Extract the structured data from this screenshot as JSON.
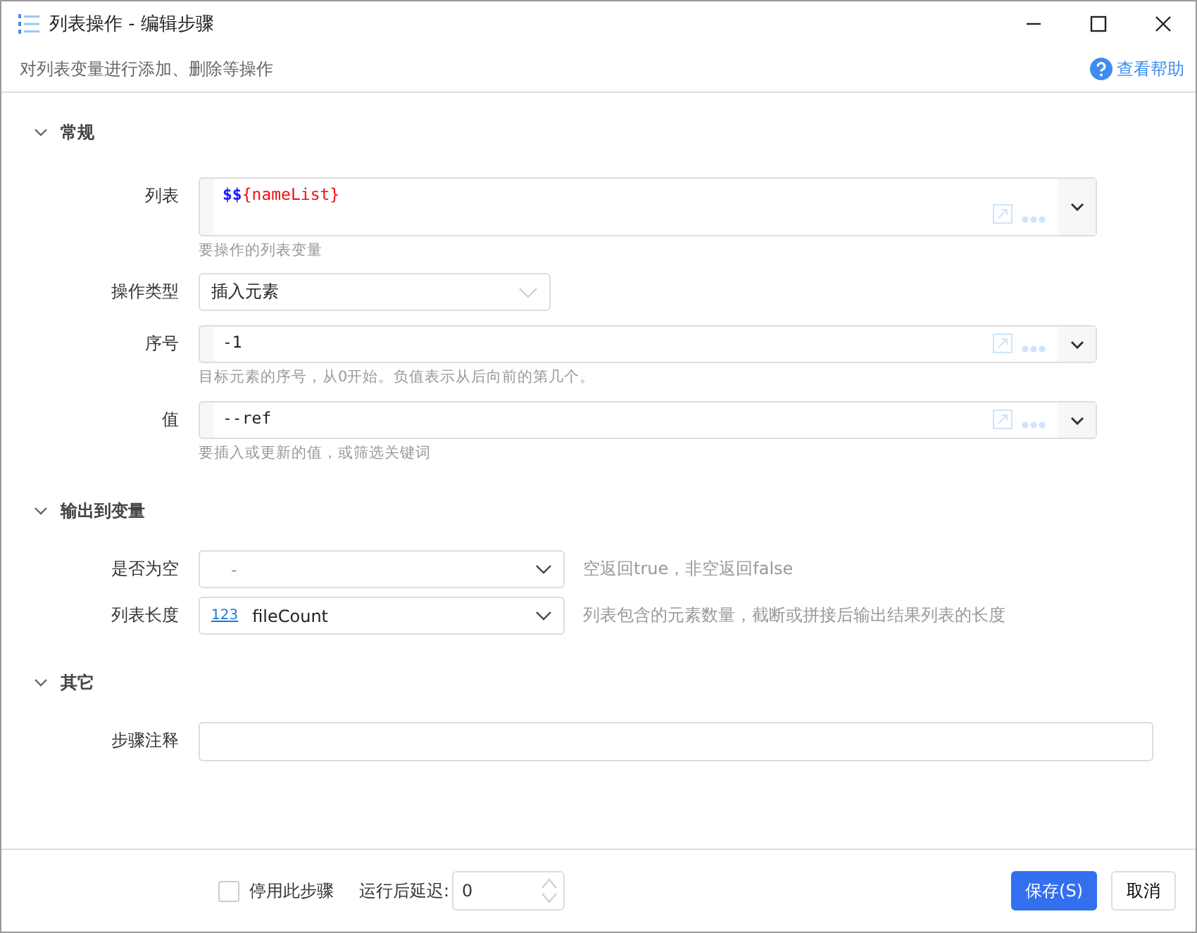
{
  "window": {
    "title": "列表操作  -  编辑步骤",
    "description": "对列表变量进行添加、删除等操作",
    "help_link": "查看帮助"
  },
  "sections": [
    {
      "title": "常规",
      "expanded": true,
      "fields": [
        {
          "kind": "code",
          "label": "列表",
          "segments": [
            {
              "kind": "prefix",
              "text": "$$"
            },
            {
              "kind": "variable",
              "text": "{nameList}"
            }
          ],
          "hint": "要操作的列表变量",
          "multiline": true
        },
        {
          "kind": "select",
          "label": "操作类型",
          "value": "插入元素"
        },
        {
          "kind": "code",
          "label": "序号",
          "segments": [
            {
              "kind": "plain",
              "text": "-1"
            }
          ],
          "hint": "目标元素的序号，从0开始。负值表示从后向前的第几个。",
          "multiline": false
        },
        {
          "kind": "code",
          "label": "值",
          "segments": [
            {
              "kind": "plain",
              "text": "--ref"
            }
          ],
          "hint": "要插入或更新的值，或筛选关键词",
          "multiline": false
        }
      ]
    },
    {
      "title": "输出到变量",
      "expanded": true,
      "fields": [
        {
          "kind": "output",
          "label": "是否为空",
          "placeholder": "-",
          "note": "空返回true，非空返回false"
        },
        {
          "kind": "output",
          "label": "列表长度",
          "type_badge": "123",
          "value": "fileCount",
          "note": "列表包含的元素数量，截断或拼接后输出结果列表的长度"
        }
      ]
    },
    {
      "title": "其它",
      "expanded": true,
      "fields": [
        {
          "kind": "text",
          "label": "步骤注释"
        }
      ]
    }
  ],
  "footer": {
    "disable_label": "停用此步骤",
    "disabled": false,
    "delay_label": "运行后延迟:",
    "delay_value": "0",
    "save": "保存(S)",
    "cancel": "取消"
  }
}
